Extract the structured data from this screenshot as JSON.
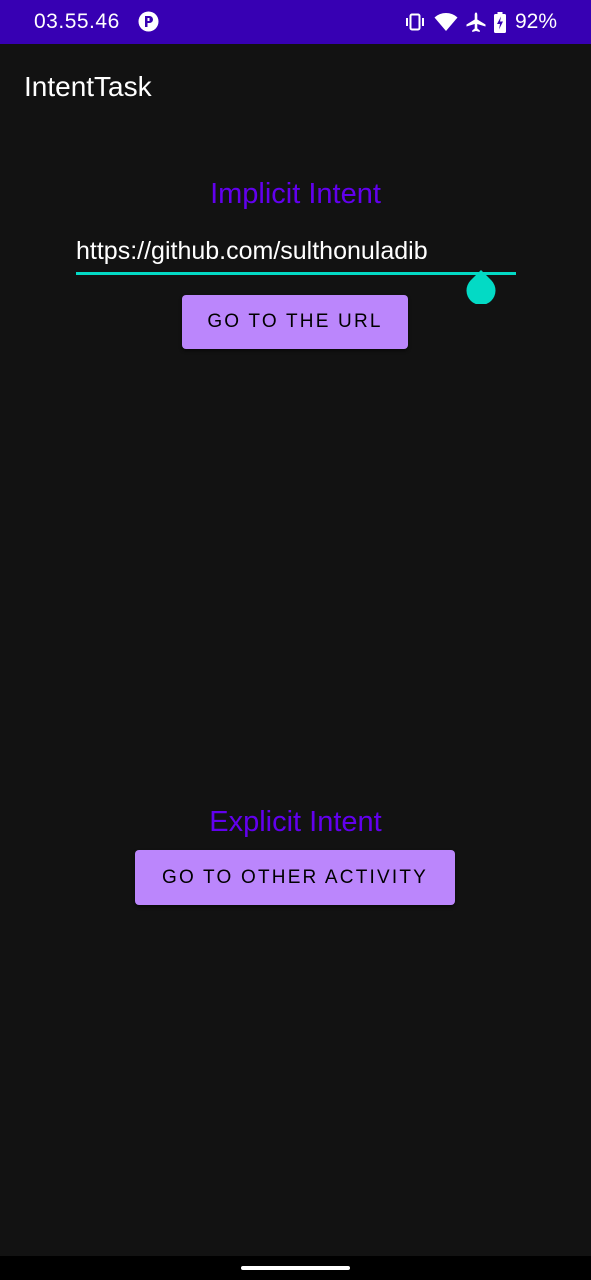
{
  "status_bar": {
    "time": "03.55.46",
    "battery_percent": "92%",
    "background": "#3700b3",
    "icons": [
      "app-notification-icon",
      "vibrate-icon",
      "wifi-icon",
      "airplane-mode-icon",
      "battery-charging-icon"
    ]
  },
  "toolbar": {
    "title": "IntentTask"
  },
  "implicit_section": {
    "title": "Implicit Intent",
    "url_value": "https://github.com/sulthonuladib",
    "button_label": "GO TO THE URL"
  },
  "explicit_section": {
    "title": "Explicit Intent",
    "button_label": "GO TO OTHER ACTIVITY"
  },
  "colors": {
    "background": "#121212",
    "heading": "#6200ee",
    "button": "#bb86fc",
    "accent": "#03dac5"
  }
}
